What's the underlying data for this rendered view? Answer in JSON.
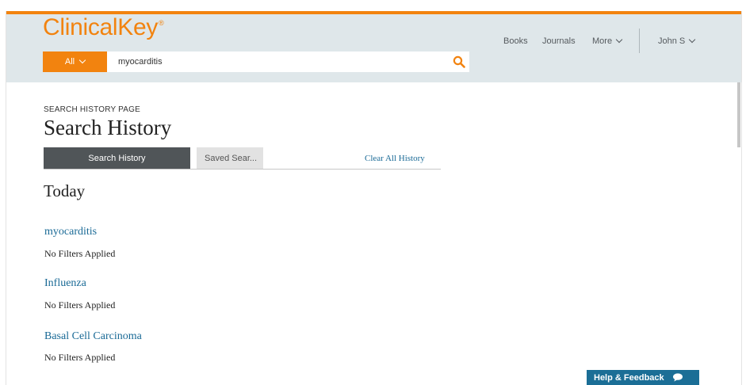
{
  "header": {
    "logo": "ClinicalKey",
    "logo_mark": "®",
    "search": {
      "scope_label": "All",
      "query": "myocarditis"
    },
    "nav": {
      "books": "Books",
      "journals": "Journals",
      "more": "More",
      "user": "John S"
    }
  },
  "page": {
    "breadcrumb": "SEARCH HISTORY PAGE",
    "title": "Search History",
    "tabs": [
      {
        "label": "Search History",
        "active": true
      },
      {
        "label": "Saved Sear...",
        "active": false
      }
    ],
    "clear_all": "Clear All History"
  },
  "history": {
    "group_label": "Today",
    "items": [
      {
        "query": "myocarditis",
        "filters": "No Filters Applied"
      },
      {
        "query": "Influenza",
        "filters": "No Filters Applied"
      },
      {
        "query": "Basal Cell Carcinoma",
        "filters": "No Filters Applied"
      }
    ]
  },
  "footer": {
    "help_label": "Help & Feedback"
  },
  "colors": {
    "brand_orange": "#f2830f",
    "header_bg": "#dfe7ea",
    "link_blue": "#1a6a96",
    "tab_active_bg": "#505558",
    "help_button_bg": "#1b6e96"
  },
  "icons": {
    "search": "search-icon",
    "chevron": "chevron-down-icon",
    "chat": "chat-bubble-icon"
  }
}
